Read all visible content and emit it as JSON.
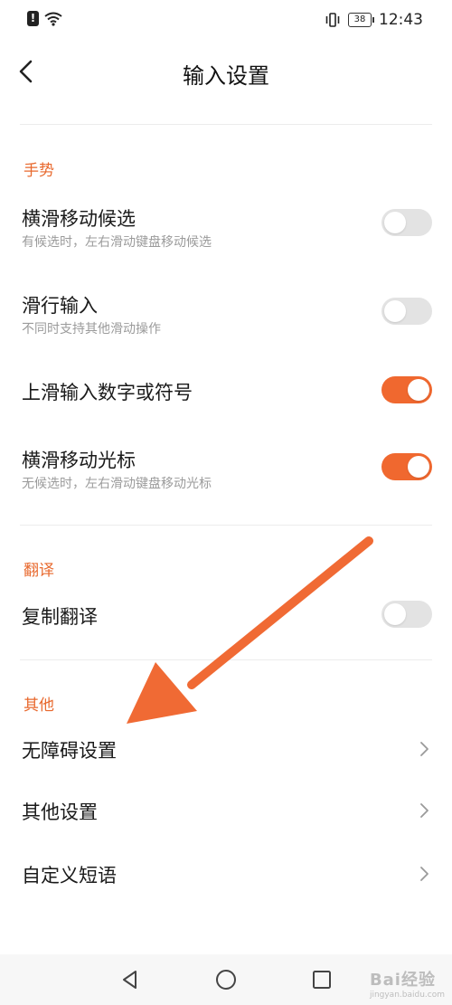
{
  "status_bar": {
    "time": "12:43",
    "battery": "38"
  },
  "header": {
    "title": "输入设置"
  },
  "sections": {
    "gesture": {
      "title": "手势",
      "items": [
        {
          "label": "横滑移动候选",
          "sub": "有候选时，左右滑动键盘移动候选",
          "on": false
        },
        {
          "label": "滑行输入",
          "sub": "不同时支持其他滑动操作",
          "on": false
        },
        {
          "label": "上滑输入数字或符号",
          "on": true
        },
        {
          "label": "横滑移动光标",
          "sub": "无候选时，左右滑动键盘移动光标",
          "on": true
        }
      ]
    },
    "translate": {
      "title": "翻译",
      "items": [
        {
          "label": "复制翻译",
          "on": false
        }
      ]
    },
    "other": {
      "title": "其他",
      "items": [
        {
          "label": "无障碍设置"
        },
        {
          "label": "其他设置"
        },
        {
          "label": "自定义短语"
        }
      ]
    }
  },
  "watermark": {
    "text": "Bai经验",
    "sub": "jingyan.baidu.com"
  },
  "colors": {
    "accent": "#f0682f",
    "section_title": "#e8692e",
    "toggle_off": "#e3e3e3"
  },
  "icons": [
    "alert-icon",
    "wifi-icon",
    "vibrate-icon",
    "battery-icon",
    "back-icon",
    "chevron-right-icon",
    "nav-back-icon",
    "nav-home-icon",
    "nav-recents-icon"
  ]
}
